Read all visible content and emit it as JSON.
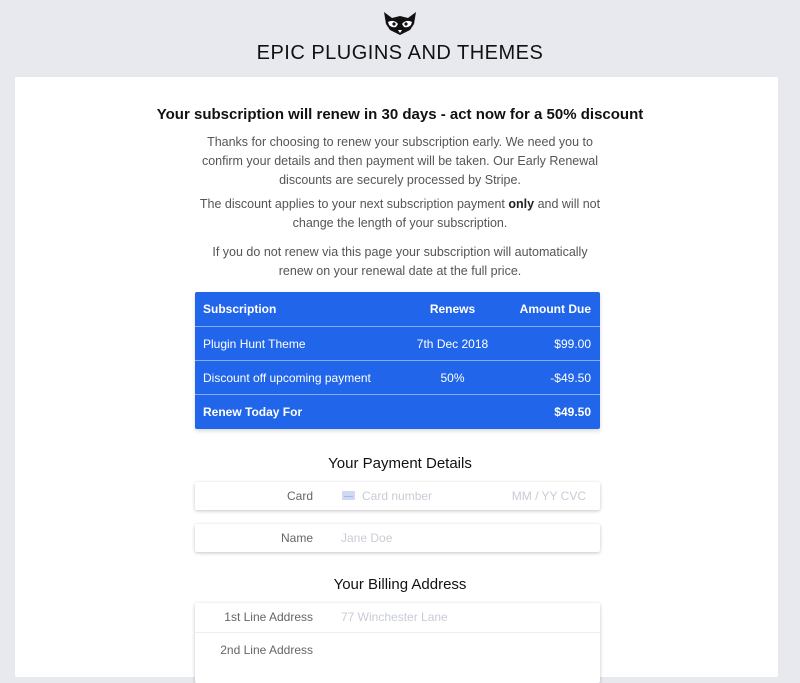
{
  "brand": {
    "name": "EPIC PLUGINS AND THEMES",
    "logo_icon": "raccoon-icon"
  },
  "headline": "Your subscription will renew in 30 days - act now for a 50% discount",
  "intro": {
    "p1": "Thanks for choosing to renew your subscription early. We need you to confirm your details and then payment will be taken. Our Early Renewal discounts are securely processed by Stripe.",
    "p2_before": "The discount applies to your next subscription payment ",
    "p2_bold": "only",
    "p2_after": " and will not change the length of your subscription.",
    "p3": "If you do not renew via this page your subscription will automatically renew on your renewal date at the full price."
  },
  "table": {
    "headers": {
      "subscription": "Subscription",
      "renews": "Renews",
      "amount": "Amount Due"
    },
    "rows": [
      {
        "subscription": "Plugin Hunt Theme",
        "renews": "7th Dec 2018",
        "amount": "$99.00"
      },
      {
        "subscription": "Discount off upcoming payment",
        "renews": "50%",
        "amount": "-$49.50"
      }
    ],
    "total": {
      "label": "Renew Today For",
      "amount": "$49.50"
    },
    "accent": "#2166ea"
  },
  "payment": {
    "title": "Your Payment Details",
    "card_label": "Card",
    "card_placeholder": "Card number",
    "card_expiry_cvc": "MM / YY  CVC",
    "name_label": "Name",
    "name_placeholder": "Jane Doe"
  },
  "billing": {
    "title": "Your Billing Address",
    "line1_label": "1st Line Address",
    "line1_placeholder": "77 Winchester Lane",
    "line2_label": "2nd Line Address",
    "line2_placeholder": ""
  }
}
